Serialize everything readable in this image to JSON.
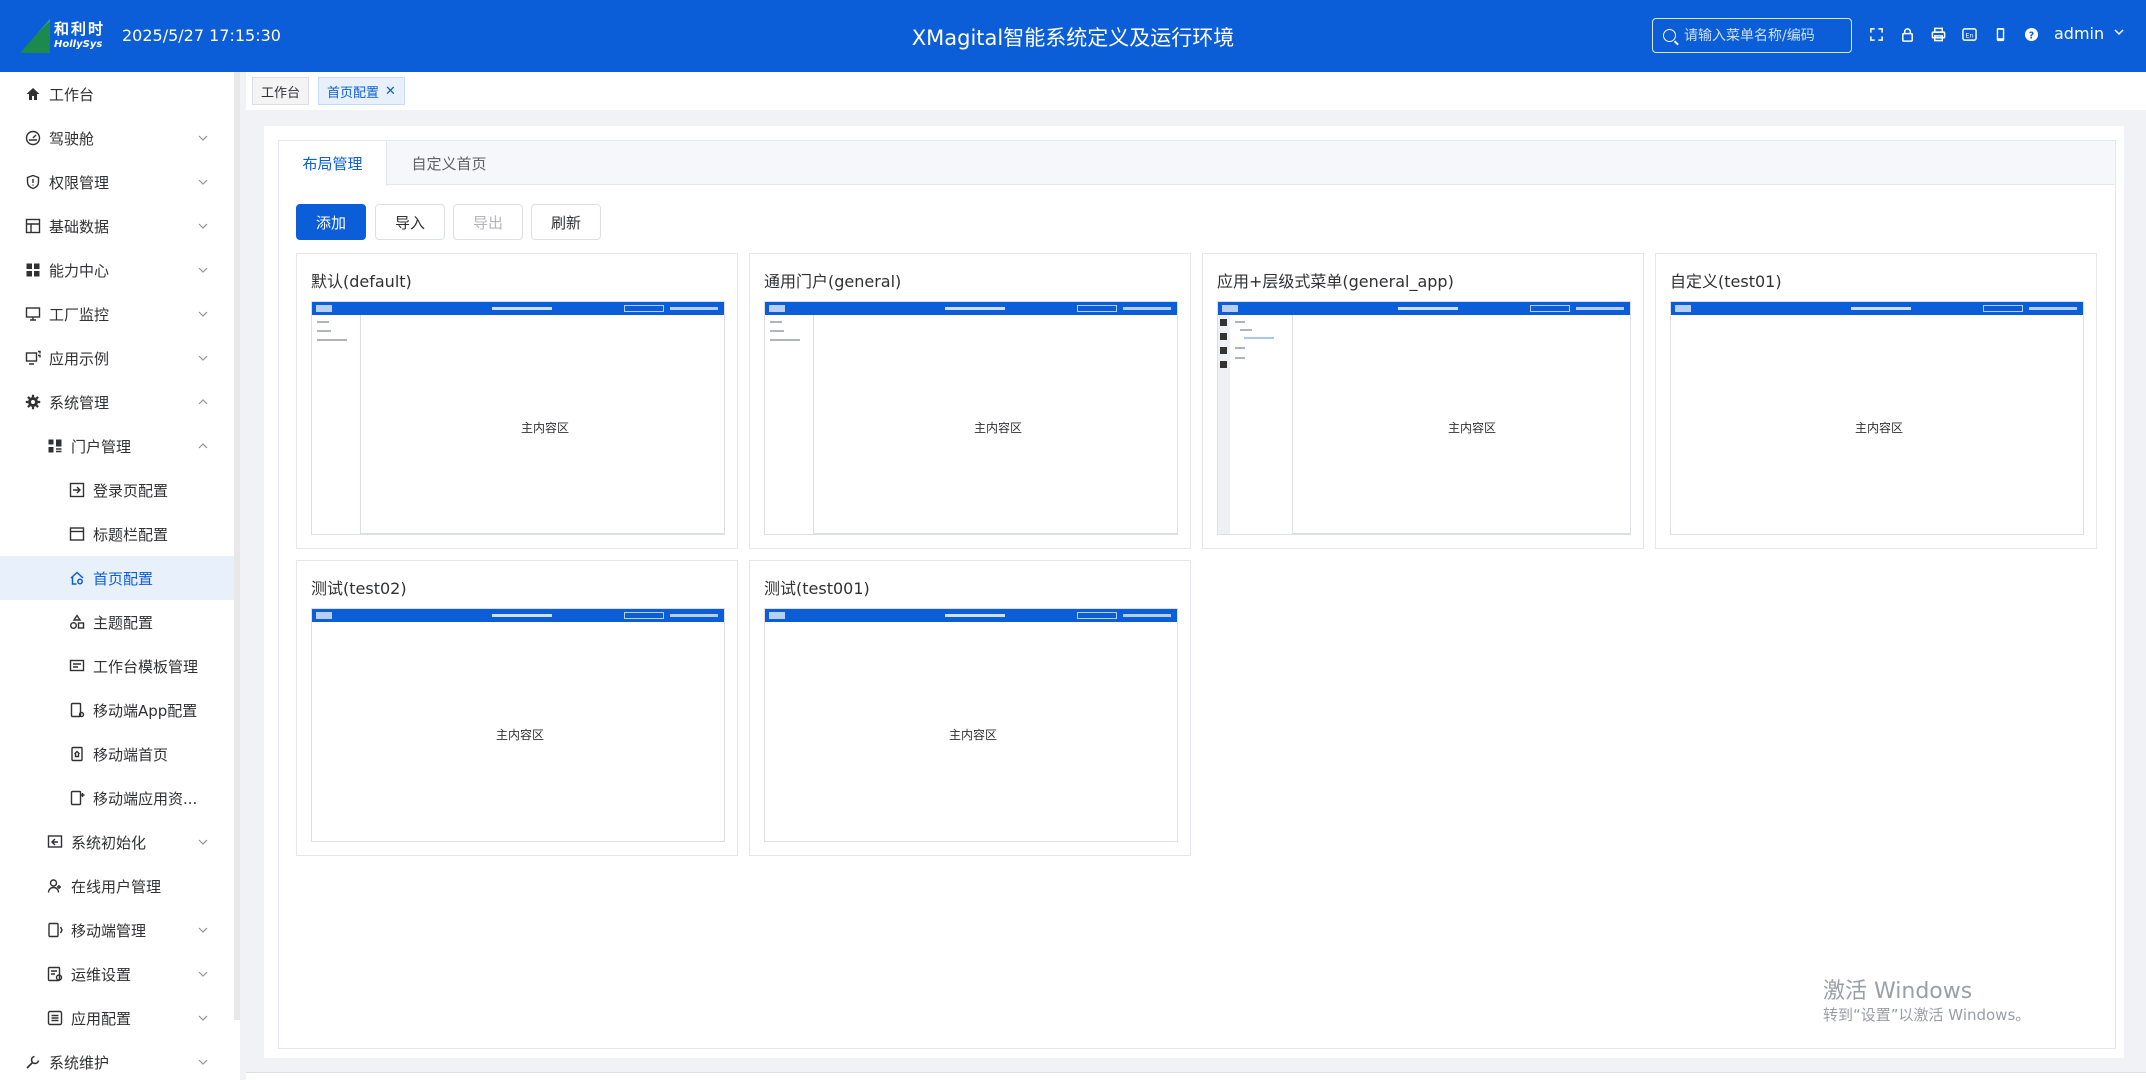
{
  "header": {
    "logo_cn": "和利时",
    "logo_en": "HollySys",
    "datetime": "2025/5/27 17:15:30",
    "title": "XMagital智能系统定义及运行环境",
    "search_placeholder": "请输入菜单名称/编码",
    "icons": [
      "fullscreen-icon",
      "lock-icon",
      "print-icon",
      "language-icon",
      "mobile-icon",
      "help-icon"
    ],
    "lang_badge": "En",
    "username": "admin"
  },
  "sidebar": {
    "items": [
      {
        "label": "工作台",
        "icon": "home-icon"
      },
      {
        "label": "驾驶舱",
        "icon": "dashboard-icon"
      },
      {
        "label": "权限管理",
        "icon": "shield-icon"
      },
      {
        "label": "基础数据",
        "icon": "table-icon"
      },
      {
        "label": "能力中心",
        "icon": "grid-icon"
      },
      {
        "label": "工厂监控",
        "icon": "monitor-icon"
      },
      {
        "label": "应用示例",
        "icon": "app-example-icon"
      },
      {
        "label": "系统管理",
        "icon": "gear-icon"
      },
      {
        "label": "门户管理",
        "icon": "portal-icon"
      },
      {
        "label": "登录页配置",
        "icon": "login-icon"
      },
      {
        "label": "标题栏配置",
        "icon": "titlebar-icon"
      },
      {
        "label": "首页配置",
        "icon": "home-config-icon"
      },
      {
        "label": "主题配置",
        "icon": "theme-icon"
      },
      {
        "label": "工作台模板管理",
        "icon": "template-icon"
      },
      {
        "label": "移动端App配置",
        "icon": "mobile-config-icon"
      },
      {
        "label": "移动端首页",
        "icon": "mobile-home-icon"
      },
      {
        "label": "移动端应用资...",
        "icon": "mobile-resource-icon"
      },
      {
        "label": "系统初始化",
        "icon": "init-icon"
      },
      {
        "label": "在线用户管理",
        "icon": "online-user-icon"
      },
      {
        "label": "移动端管理",
        "icon": "mobile-manage-icon"
      },
      {
        "label": "运维设置",
        "icon": "ops-icon"
      },
      {
        "label": "应用配置",
        "icon": "app-config-icon"
      },
      {
        "label": "系统维护",
        "icon": "maintenance-icon"
      }
    ]
  },
  "tabbar": {
    "tabs": [
      {
        "label": "工作台"
      },
      {
        "label": "首页配置",
        "close": "✕"
      }
    ]
  },
  "panel": {
    "tabs": [
      "布局管理",
      "自定义首页"
    ],
    "buttons": {
      "add": "添加",
      "import": "导入",
      "export": "导出",
      "refresh": "刷新"
    },
    "cards": [
      {
        "title": "默认(default)",
        "main_label": "主内容区"
      },
      {
        "title": "通用门户(general)",
        "main_label": "主内容区"
      },
      {
        "title": "应用+层级式菜单(general_app)",
        "main_label": "主内容区"
      },
      {
        "title": "自定义(test01)",
        "main_label": "主内容区"
      },
      {
        "title": "测试(test02)",
        "main_label": "主内容区"
      },
      {
        "title": "测试(test001)",
        "main_label": "主内容区"
      }
    ]
  },
  "watermark": {
    "line1": "激活 Windows",
    "line2": "转到“设置”以激活 Windows。"
  },
  "colors": {
    "primary": "#0b5ed7",
    "active_bg": "#e8f0fb"
  }
}
